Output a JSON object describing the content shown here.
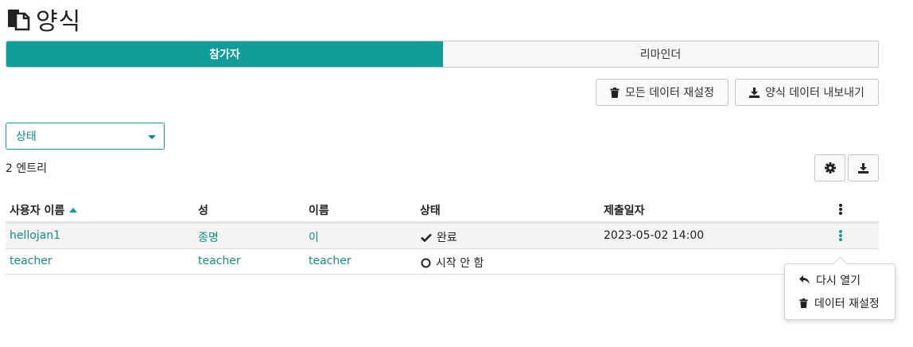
{
  "page": {
    "title": "양식"
  },
  "tabs": [
    {
      "label": "참가자",
      "active": true
    },
    {
      "label": "리마인더",
      "active": false
    }
  ],
  "actions": {
    "reset_all": "모든 데이터 재설정",
    "export": "양식 데이터 내보내기"
  },
  "filter": {
    "selected": "상태"
  },
  "entries": {
    "count_label": "2 엔트리"
  },
  "table": {
    "columns": [
      "사용자 이름",
      "성",
      "이름",
      "상태",
      "제출일자"
    ],
    "sort": {
      "column": "사용자 이름",
      "direction": "ascending"
    },
    "rows": [
      {
        "username": "hellojan1",
        "lastname": "종명",
        "firstname": "이",
        "status": "완료",
        "status_icon": "check-icon",
        "submitted": "2023-05-02 14:00"
      },
      {
        "username": "teacher",
        "lastname": "teacher",
        "firstname": "teacher",
        "status": "시작 안 함",
        "status_icon": "circle-icon",
        "submitted": ""
      }
    ]
  },
  "popover_menu": {
    "items": [
      {
        "label": "다시 열기",
        "icon": "reply-icon"
      },
      {
        "label": "데이터 재설정",
        "icon": "trash-icon"
      }
    ]
  },
  "colors": {
    "accent": "#0f9d9a",
    "link": "#128f8c",
    "text": "#222222"
  }
}
